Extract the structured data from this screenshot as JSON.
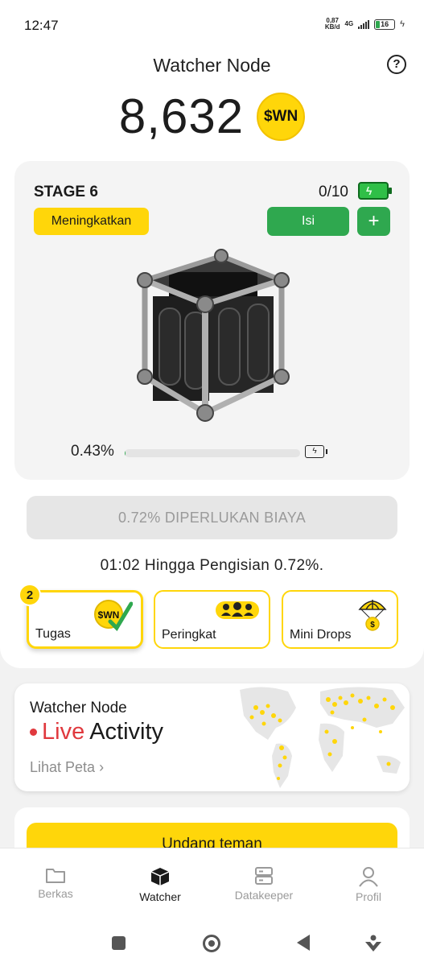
{
  "status_bar": {
    "time": "12:47",
    "net_speed_value": "0,87",
    "net_speed_unit": "KB/d",
    "network": "4G",
    "battery": "16"
  },
  "header": {
    "title": "Watcher Node",
    "balance": "8,632",
    "coin_label": "$WN"
  },
  "stage": {
    "label": "STAGE 6",
    "energy_count": "0/10",
    "upgrade_label": "Meningkatkan",
    "fill_label": "Isi",
    "plus_label": "+",
    "progress_text": "0.43%",
    "progress_fraction": 0.0043
  },
  "cost_text": "0.72% DIPERLUKAN BIAYA",
  "timer_text": "01:02 Hingga Pengisian 0.72%.",
  "tiles": [
    {
      "label": "Tugas",
      "badge": "2",
      "icon": "wn-coin-check-icon"
    },
    {
      "label": "Peringkat",
      "icon": "people-group-icon"
    },
    {
      "label": "Mini Drops",
      "icon": "parachute-coin-icon"
    }
  ],
  "live": {
    "title": "Watcher Node",
    "live_word": "Live",
    "activity_word": "Activity",
    "map_link": "Lihat Peta",
    "map_link_chevron": "›"
  },
  "invite_label": "Undang teman",
  "bottom_nav": [
    {
      "label": "Berkas",
      "icon": "folder-icon"
    },
    {
      "label": "Watcher",
      "icon": "cube-icon",
      "active": true
    },
    {
      "label": "Datakeeper",
      "icon": "server-icon"
    },
    {
      "label": "Profil",
      "icon": "user-icon"
    }
  ],
  "colors": {
    "accent_yellow": "#ffd60a",
    "action_green": "#2fa84f",
    "live_red": "#e0393e"
  }
}
